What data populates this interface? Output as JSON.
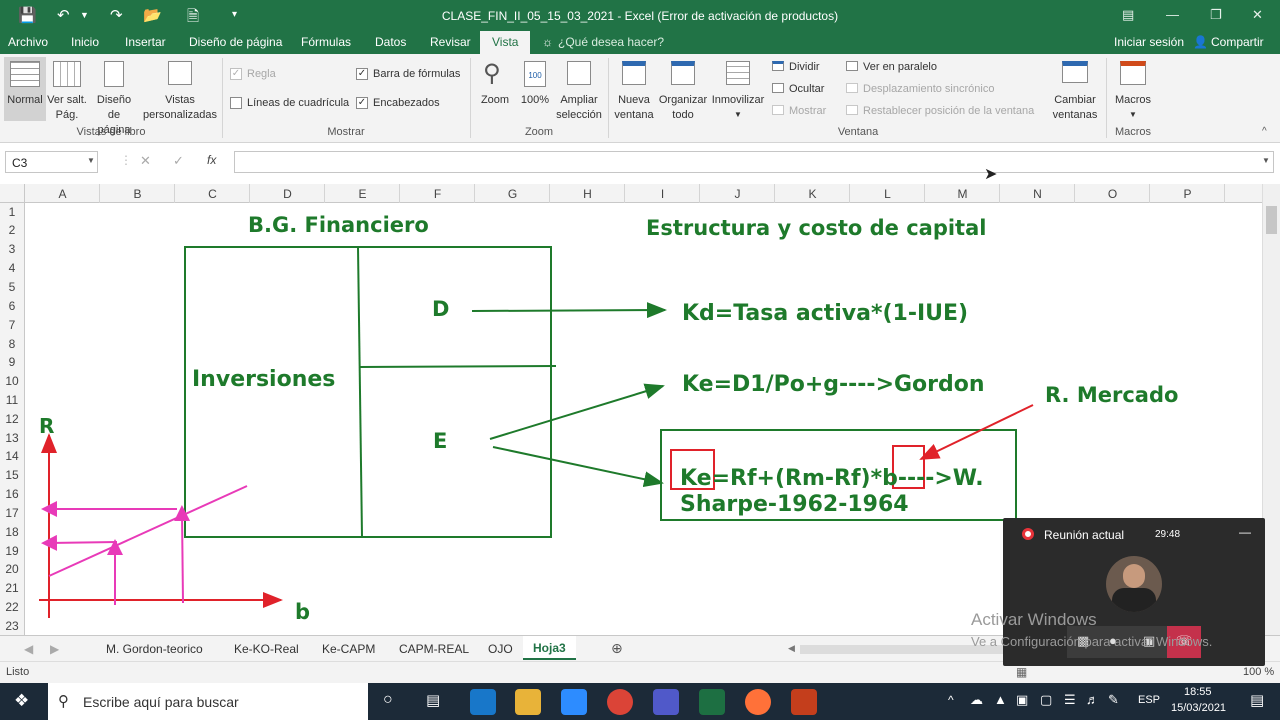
{
  "window": {
    "title": "CLASE_FIN_II_05_15_03_2021 - Excel (Error de activación de productos)"
  },
  "ribbon_tabs": [
    "Archivo",
    "Inicio",
    "Insertar",
    "Diseño de página",
    "Fórmulas",
    "Datos",
    "Revisar",
    "Vista"
  ],
  "active_tab": "Vista",
  "tell_me": "¿Qué desea hacer?",
  "account": {
    "signin": "Iniciar sesión",
    "share": "Compartir"
  },
  "ribbon": {
    "views": {
      "normal": "Normal",
      "page_break_1": "Ver salt.",
      "page_break_2": "Pág.",
      "page_layout_1": "Diseño",
      "page_layout_2": "de página",
      "custom_1": "Vistas",
      "custom_2": "personalizadas",
      "group": "Vistas de libro"
    },
    "show": {
      "ruler": "Regla",
      "formula_bar": "Barra de fórmulas",
      "gridlines": "Líneas de cuadrícula",
      "headings": "Encabezados",
      "group": "Mostrar"
    },
    "zoom": {
      "zoom": "Zoom",
      "hundred": "100%",
      "sel_1": "Ampliar",
      "sel_2": "selección",
      "group": "Zoom"
    },
    "window": {
      "new_1": "Nueva",
      "new_2": "ventana",
      "arrange_1": "Organizar",
      "arrange_2": "todo",
      "freeze": "Inmovilizar",
      "split": "Dividir",
      "hide": "Ocultar",
      "show": "Mostrar",
      "side": "Ver en paralelo",
      "sync": "Desplazamiento sincrónico",
      "reset": "Restablecer posición de la ventana",
      "switch_1": "Cambiar",
      "switch_2": "ventanas",
      "group": "Ventana"
    },
    "macros": {
      "label": "Macros",
      "group": "Macros"
    }
  },
  "name_box": "C3",
  "fx": "fx",
  "columns": [
    "A",
    "B",
    "C",
    "D",
    "E",
    "F",
    "G",
    "H",
    "I",
    "J",
    "K",
    "L",
    "M",
    "N",
    "O",
    "P"
  ],
  "rows": [
    "1",
    "2",
    "3",
    "4",
    "5",
    "6",
    "7",
    "8",
    "9",
    "10",
    "11",
    "12",
    "13",
    "14",
    "15",
    "16",
    "17",
    "18",
    "19",
    "20",
    "21",
    "22",
    "23"
  ],
  "drawing": {
    "bg_title": "B.G. Financiero",
    "capital_title": "Estructura y costo de capital",
    "inversiones": "Inversiones",
    "d": "D",
    "e": "E",
    "kd": "Kd=Tasa activa*(1-IUE)",
    "ke_gordon": "Ke=D1/Po+g---->Gordon",
    "r_mercado": "R. Mercado",
    "capm_ke": "Ke",
    "capm_mid": "=Rf+(Rm-Rf)*",
    "capm_b": "b",
    "capm_tail": "---->W.",
    "capm_line2": "Sharpe-1962-1964",
    "axis_r": "R",
    "axis_b": "b",
    "ink_green": "#1e7a2b",
    "ink_pink": "#e83ab8",
    "ink_red": "#e0222a"
  },
  "sheet_tabs": [
    "M. Gordon-teorico",
    "Ke-KO-Real",
    "Ke-CAPM",
    "CAPM-REAL",
    "OJO",
    "Hoja3"
  ],
  "active_sheet": "Hoja3",
  "status": {
    "ready": "Listo",
    "zoom": "100 %"
  },
  "meeting": {
    "title": "Reunión actual",
    "time": "29:48"
  },
  "watermark": {
    "line1": "Activar Windows",
    "line2": "Ve a Configuración para activar Windows."
  },
  "taskbar": {
    "search": "Escribe aquí para buscar",
    "lang": "ESP",
    "time": "18:55",
    "date": "15/03/2021"
  }
}
